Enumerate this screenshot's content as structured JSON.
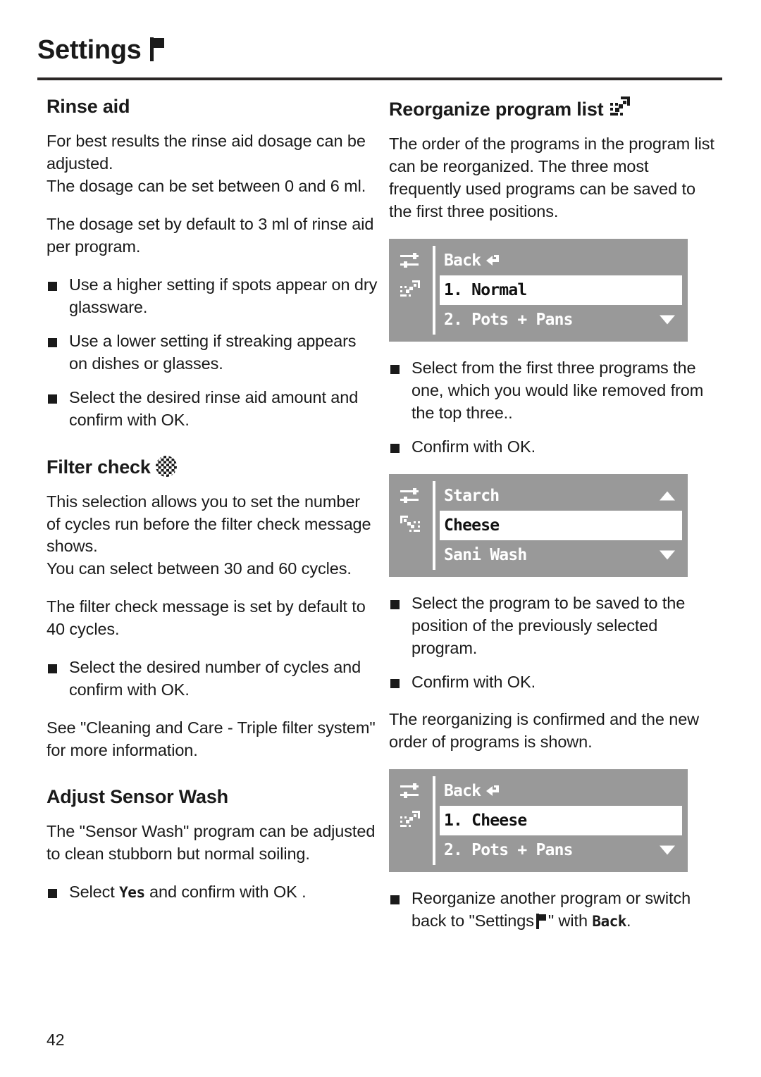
{
  "header": {
    "title": "Settings",
    "icon": "flag-icon"
  },
  "page_number": "42",
  "left_column": {
    "sections": [
      {
        "id": "rinse-aid",
        "title": "Rinse aid",
        "paragraphs": [
          "For best results the rinse aid dosage can be adjusted.",
          "The dosage can be set between 0 and 6 ml.",
          "The dosage set by default to 3 ml of rinse aid per program."
        ],
        "bullets": [
          "Use a higher setting if spots appear on dry glassware.",
          "Use a lower setting if streaking appears on dishes or glasses.",
          "Select the desired rinse aid amount and confirm with OK."
        ]
      },
      {
        "id": "filter-check",
        "title": "Filter check",
        "icon": "mesh-filter-icon",
        "paragraphs": [
          "This selection allows you to set the number of cycles run before the filter check message shows.",
          "You can select between 30 and 60 cycles.",
          "The filter check message is set by default to 40 cycles."
        ],
        "bullets": [
          "Select the desired number of cycles and confirm with OK."
        ],
        "closing_paragraph": "See \"Cleaning and Care - Triple filter system\" for more information."
      },
      {
        "id": "adjust-sensor-wash",
        "title": "Adjust Sensor Wash",
        "paragraphs": [
          "The \"Sensor Wash\" program can be adjusted to clean stubborn but normal soiling."
        ],
        "bullet_prefix": "Select ",
        "bullet_lcd_token": "Yes",
        "bullet_suffix": " and confirm with OK ."
      }
    ]
  },
  "right_column": {
    "section": {
      "id": "reorganize-program-list",
      "title": "Reorganize program list",
      "icon": "reorganize-icon",
      "intro": "The order of the programs in the program list can be reorganized. The three most frequently used programs can be saved to the first three positions."
    },
    "displays": [
      {
        "id": "display-1",
        "icons": [
          "settings-sliders-icon",
          "reorganize-icon"
        ],
        "rows": [
          {
            "label": "Back",
            "trailing_glyph": "back-arrow",
            "selected": false,
            "scroll_arrow": ""
          },
          {
            "label": "1. Normal",
            "trailing_glyph": "",
            "selected": true,
            "scroll_arrow": ""
          },
          {
            "label": "2. Pots + Pans",
            "trailing_glyph": "",
            "selected": false,
            "scroll_arrow": "down"
          }
        ]
      },
      {
        "id": "display-2",
        "icons": [
          "settings-sliders-icon",
          "reorganize-flipped-icon"
        ],
        "rows": [
          {
            "label": "Starch",
            "trailing_glyph": "",
            "selected": false,
            "scroll_arrow": "up"
          },
          {
            "label": "Cheese",
            "trailing_glyph": "",
            "selected": true,
            "scroll_arrow": ""
          },
          {
            "label": "Sani Wash",
            "trailing_glyph": "",
            "selected": false,
            "scroll_arrow": "down"
          }
        ]
      },
      {
        "id": "display-3",
        "icons": [
          "settings-sliders-icon",
          "reorganize-icon"
        ],
        "rows": [
          {
            "label": "Back",
            "trailing_glyph": "back-arrow",
            "selected": false,
            "scroll_arrow": ""
          },
          {
            "label": "1. Cheese",
            "trailing_glyph": "",
            "selected": true,
            "scroll_arrow": ""
          },
          {
            "label": "2. Pots + Pans",
            "trailing_glyph": "",
            "selected": false,
            "scroll_arrow": "down"
          }
        ]
      }
    ],
    "bullets_after_display_1": [
      "Select from the first three programs the one, which you would like removed from the top three..",
      "Confirm with OK."
    ],
    "bullets_after_display_2": [
      "Select the program to be saved to the position of the previously selected program.",
      "Confirm with OK."
    ],
    "paragraph_after_display_2": "The reorganizing is confirmed and the new order of programs is shown.",
    "final_bullet": {
      "part1": "Reorganize another program or switch back to \"Settings",
      "part2": "\" with ",
      "lcd_token": "Back",
      "part3": "."
    }
  },
  "colors": {
    "lcd_background": "#999999",
    "lcd_text": "#ffffff",
    "lcd_selected_bg": "#ffffff",
    "lcd_selected_text": "#111111",
    "text": "#1a1a1a",
    "rule": "#2b2726"
  }
}
